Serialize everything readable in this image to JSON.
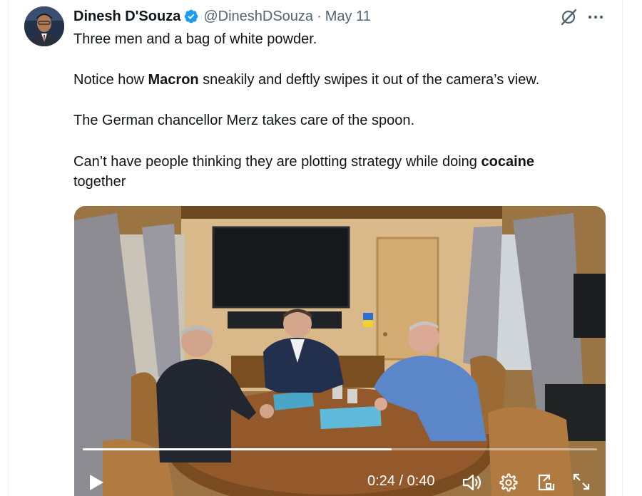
{
  "tweet": {
    "author_name": "Dinesh D'Souza",
    "handle": "@DineshDSouza",
    "separator": "·",
    "date": "May 11",
    "paragraphs": {
      "p1": "Three men and a bag of white powder.",
      "p2_before": "Notice how ",
      "p2_bold": "Macron",
      "p2_after": " sneakily and deftly swipes it out of the camera’s view.",
      "p3": "The German chancellor Merz takes care of the spoon.",
      "p4_before": "Can’t have people thinking they are plotting strategy while doing ",
      "p4_bold": "cocaine",
      "p4_line2": "together"
    }
  },
  "icons": {
    "verified": "verified-badge-icon",
    "grok": "grok-icon",
    "more": "more-options-icon",
    "play": "play-icon",
    "volume": "volume-icon",
    "settings": "gear-icon",
    "pip": "picture-in-picture-icon",
    "fullscreen": "fullscreen-icon"
  },
  "video": {
    "current_time": "0:24",
    "duration": "0:40",
    "time_display": "0:24 / 0:40",
    "progress_fraction": 0.6
  },
  "colors": {
    "verified_blue": "#1d9bf0",
    "secondary_text": "#536471",
    "primary_text": "#0f1419"
  }
}
